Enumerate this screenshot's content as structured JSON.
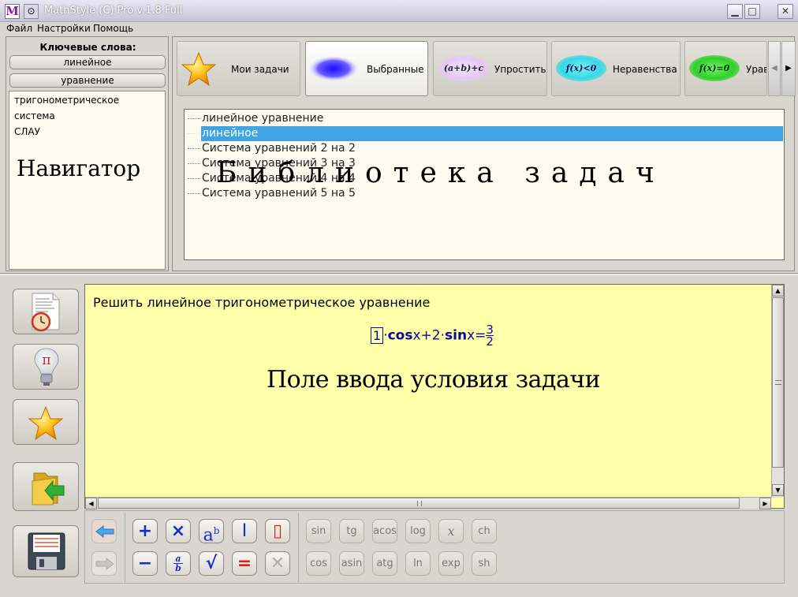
{
  "window": {
    "title": "MathStyle (C) Pro v.1.8 Full",
    "app_icon_letter": "M",
    "min_glyph": "▁",
    "max_glyph": "□",
    "close_glyph": "✕"
  },
  "menu": {
    "items": [
      "Файл",
      "Настройки",
      "Помощь"
    ]
  },
  "navigator": {
    "keywords_label": "Ключевые слова:",
    "selected_keywords": [
      "линейное",
      "уравнение"
    ],
    "keyword_list": [
      "тригонометрическое",
      "система",
      "СЛАУ"
    ],
    "caption": "Навигатор"
  },
  "tabs": [
    {
      "label": "Мои задачи",
      "icon": "star-icon"
    },
    {
      "label": "Выбранные",
      "icon": "blue-oval-icon"
    },
    {
      "label": "Упростить",
      "icon": "simplify-oval-icon",
      "oval_text": "(a+b)+c"
    },
    {
      "label": "Неравенства",
      "icon": "inequality-oval-icon",
      "oval_text": "f(x)<0"
    },
    {
      "label": "Урав",
      "icon": "equation-oval-icon",
      "oval_text": "f(x)=0"
    }
  ],
  "tree": {
    "items": [
      "линейное уравнение",
      "линейное",
      "Система уравнений 2 на 2",
      "Система уравнений 3 на 3",
      "Система уравнений 4 на 4",
      "Система уравнений 5 на 5"
    ],
    "selected_index": 1,
    "caption": "Библиотека задач"
  },
  "editor": {
    "task_text": "Решить линейное тригонометрическое уравнение",
    "formula": {
      "coef1": "1",
      "dot1": "·",
      "cos": "cos",
      "x1": "x",
      "plus2": "+2·",
      "sin": "sin",
      "x2": "x",
      "eq": "=",
      "num": "3",
      "den": "2"
    },
    "caption": "Поле ввода условия задачи"
  },
  "math_buttons": {
    "plus": "+",
    "times": "×",
    "power_base": "a",
    "power_exp": "b",
    "cursor": "I",
    "box": "▯",
    "minus": "−",
    "frac_num": "a",
    "frac_den": "b",
    "sqrt": "√",
    "equals": "=",
    "delete": "✕"
  },
  "func_buttons": {
    "row1": [
      "sin",
      "tg",
      "acos",
      "log",
      "x",
      "ch"
    ],
    "row2": [
      "cos",
      "asin",
      "atg",
      "ln",
      "exp",
      "sh"
    ]
  },
  "colors": {
    "selection": "#3fa5e2",
    "editor_bg": "#ffffaa",
    "math_blue": "#1a2bc8",
    "math_red": "#e0201a"
  }
}
